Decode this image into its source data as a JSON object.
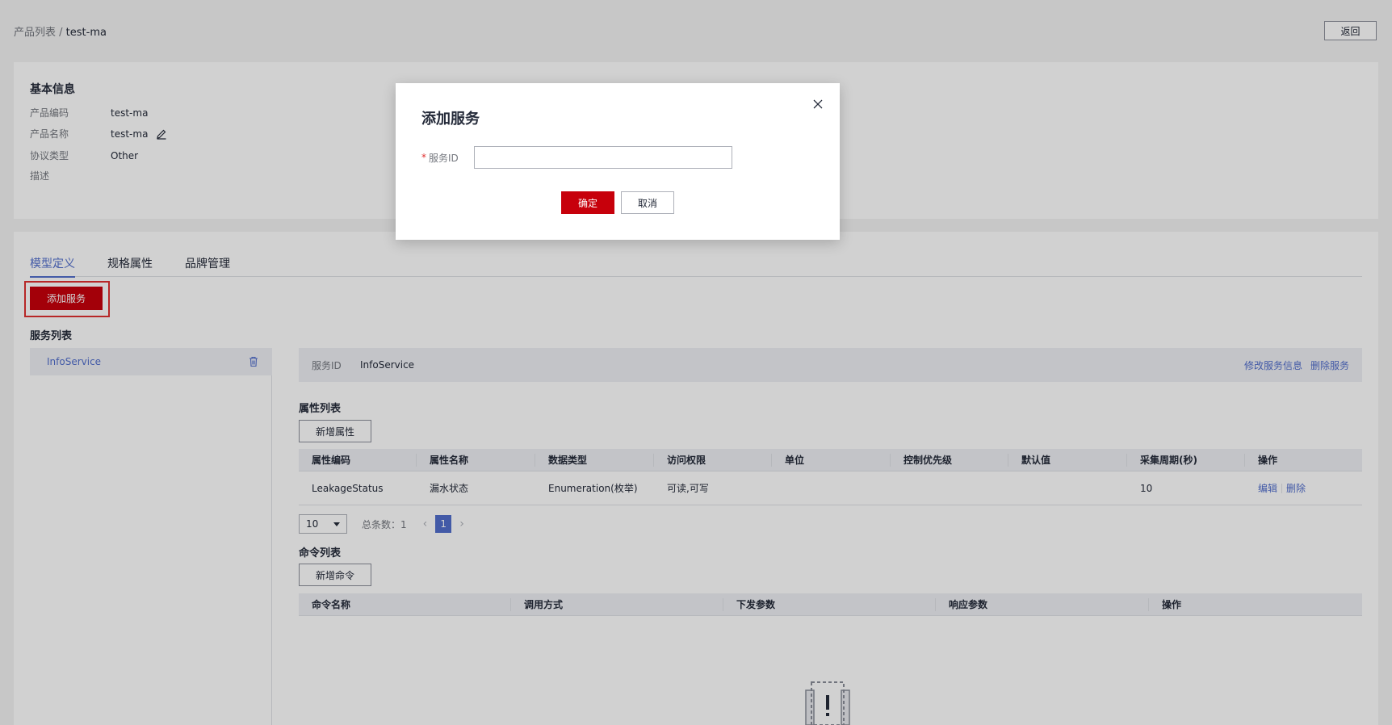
{
  "breadcrumb": {
    "parent": "产品列表",
    "separator": " / ",
    "current": "test-ma"
  },
  "header": {
    "back_label": "返回"
  },
  "basic_info": {
    "title": "基本信息",
    "rows": [
      {
        "label": "产品编码",
        "value": "test-ma"
      },
      {
        "label": "产品名称",
        "value": "test-ma"
      },
      {
        "label": "协议类型",
        "value": "Other"
      },
      {
        "label": "描述",
        "value": ""
      }
    ]
  },
  "tabs": [
    {
      "label": "模型定义",
      "active": true
    },
    {
      "label": "规格属性",
      "active": false
    },
    {
      "label": "品牌管理",
      "active": false
    }
  ],
  "add_service_label": "添加服务",
  "service_list": {
    "title": "服务列表",
    "items": [
      {
        "name": "InfoService"
      }
    ]
  },
  "service_detail": {
    "id_label": "服务ID",
    "id_value": "InfoService",
    "edit_label": "修改服务信息",
    "delete_label": "删除服务"
  },
  "properties": {
    "title": "属性列表",
    "add_label": "新增属性",
    "columns": [
      "属性编码",
      "属性名称",
      "数据类型",
      "访问权限",
      "单位",
      "控制优先级",
      "默认值",
      "采集周期(秒)",
      "操作"
    ],
    "rows": [
      {
        "code": "LeakageStatus",
        "name": "漏水状态",
        "type": "Enumeration(枚举)",
        "access": "可读,可写",
        "unit": "",
        "priority": "",
        "default": "",
        "period": "10",
        "edit": "编辑",
        "delete": "删除"
      }
    ],
    "pager": {
      "page_size": "10",
      "total_label": "总条数：1",
      "current_page": "1"
    }
  },
  "commands": {
    "title": "命令列表",
    "add_label": "新增命令",
    "columns": [
      "命令名称",
      "调用方式",
      "下发参数",
      "响应参数",
      "操作"
    ]
  },
  "modal": {
    "title": "添加服务",
    "field_label": "服务ID",
    "field_required_mark": "*",
    "field_value": "",
    "ok_label": "确定",
    "cancel_label": "取消"
  },
  "colors": {
    "primary": "#c7000b",
    "link": "#526ecc",
    "border": "#dfe1e6",
    "header_bg": "#eef0f5"
  }
}
